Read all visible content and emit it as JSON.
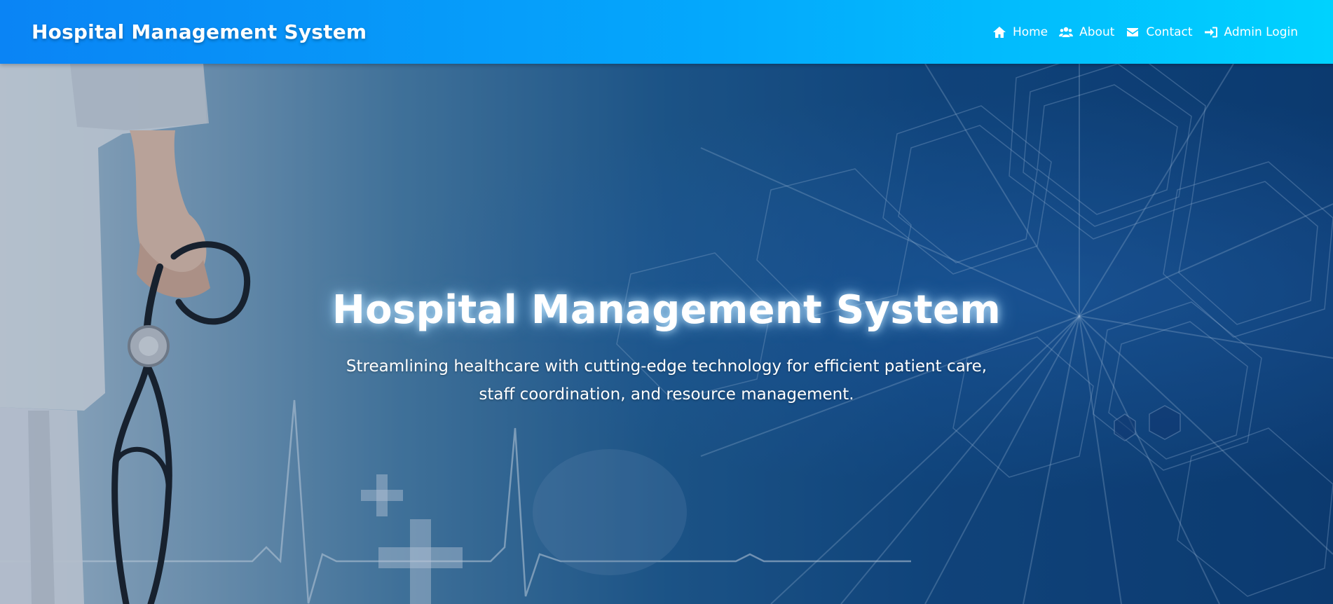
{
  "navbar": {
    "brand": "Hospital Management System",
    "links": [
      {
        "label": "Home",
        "icon": "home-icon"
      },
      {
        "label": "About",
        "icon": "users-icon"
      },
      {
        "label": "Contact",
        "icon": "envelope-icon"
      },
      {
        "label": "Admin Login",
        "icon": "sign-in-icon"
      }
    ]
  },
  "hero": {
    "title": "Hospital Management System",
    "subtitle": "Streamlining healthcare with cutting-edge technology for efficient patient care, staff coordination, and resource management.",
    "image": "doctor-with-stethoscope-medical-background"
  },
  "colors": {
    "navbar_start": "#0a84f5",
    "navbar_end": "#00d2fe",
    "hero_dark": "#0d3f78",
    "text": "#ffffff"
  }
}
